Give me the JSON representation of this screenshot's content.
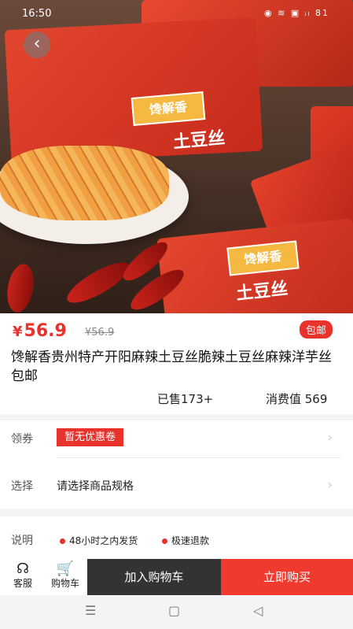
{
  "status_bar": {
    "time": "16:50",
    "right_icons": "◉ ≋ ▣ ᵢₗ 81"
  },
  "hero": {
    "label_a": "馋解香",
    "label_b": "土豆丝",
    "label_c": "馋解香",
    "label_d": "土豆丝"
  },
  "product": {
    "price_symbol": "¥",
    "price": "56.9",
    "original_price": "¥56.9",
    "free_shipping": "包邮",
    "title": "馋解香贵州特产开阳麻辣土豆丝脆辣土豆丝麻辣洋芋丝包邮",
    "sold": "已售173+",
    "consume_value": "消费值 569"
  },
  "options": {
    "coupon_label": "领券",
    "coupon_value": "暂无优惠卷",
    "select_label": "选择",
    "select_value": "请选择商品规格"
  },
  "notes": {
    "label": "说明",
    "tags": [
      "48小时之内发货",
      "极速退款"
    ]
  },
  "bottom": {
    "service": "客服",
    "cart": "购物车",
    "add_to_cart": "加入购物车",
    "buy_now": "立即购买"
  },
  "colors": {
    "accent": "#e8322b",
    "dark_button": "#333333"
  }
}
